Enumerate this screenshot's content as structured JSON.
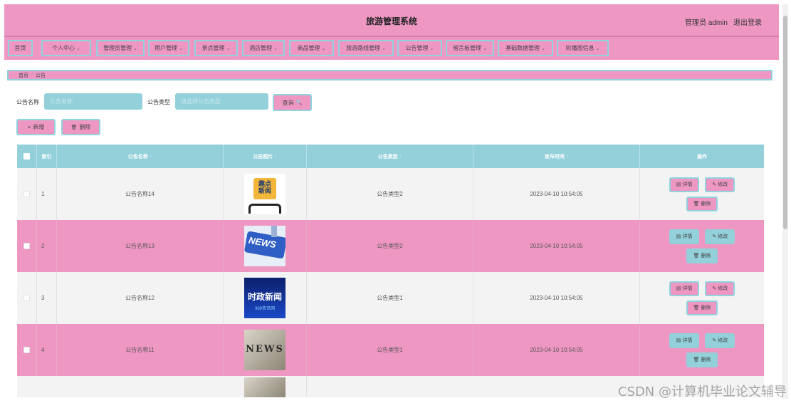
{
  "header": {
    "title": "旅游管理系统",
    "user": "管理员 admin",
    "logout": "退出登录"
  },
  "nav": [
    {
      "label": "首页",
      "chevron": ""
    },
    {
      "label": "个人中心",
      "chevron": "⌄"
    },
    {
      "label": "管理员管理",
      "chevron": "⌄"
    },
    {
      "label": "用户管理",
      "chevron": "⌄"
    },
    {
      "label": "景点管理",
      "chevron": "⌄"
    },
    {
      "label": "酒店管理",
      "chevron": "⌄"
    },
    {
      "label": "商品管理",
      "chevron": "⌄"
    },
    {
      "label": "旅游路线管理",
      "chevron": "⌄"
    },
    {
      "label": "公告管理",
      "chevron": "⌄"
    },
    {
      "label": "留言板管理",
      "chevron": "⌄"
    },
    {
      "label": "基础数据管理",
      "chevron": "⌄"
    },
    {
      "label": "轮播图信息",
      "chevron": "⌄"
    }
  ],
  "breadcrumb": {
    "home": "首页",
    "sep": "/",
    "current": "公告"
  },
  "search": {
    "name_label": "公告名称",
    "name_placeholder": "公告名称",
    "type_label": "公告类型",
    "type_placeholder": "请选择公告类型",
    "query_label": "查询",
    "query_icon": "🔍"
  },
  "actions": {
    "add_icon": "+",
    "add_label": "新增",
    "delete_icon": "🗑",
    "delete_label": "删除"
  },
  "table": {
    "columns": [
      "索引",
      "公告名称",
      "公告图片",
      "公告类型",
      "发布时间",
      "操作"
    ],
    "sort_icon": "↕",
    "rows": [
      {
        "index": "1",
        "name": "公告名称14",
        "image": "news-phone",
        "type": "公告类型2",
        "time": "2023-04-10 10:54:05"
      },
      {
        "index": "2",
        "name": "公告名称13",
        "image": "news-key",
        "type": "公告类型2",
        "time": "2023-04-10 10:54:05"
      },
      {
        "index": "3",
        "name": "公告名称12",
        "image": "news-politics",
        "type": "公告类型1",
        "time": "2023-04-10 10:54:05"
      },
      {
        "index": "4",
        "name": "公告名称11",
        "image": "news-paper",
        "type": "公告类型1",
        "time": "2023-04-10 10:54:05"
      }
    ],
    "ops": {
      "detail_icon": "▤",
      "detail": "详情",
      "edit_icon": "✎",
      "edit": "修改",
      "delete_icon": "🗑",
      "delete": "删除"
    }
  },
  "thumb_text": {
    "phone_line1": "趣点",
    "phone_line2": "新闻",
    "key": "NEWS",
    "politics_line1": "时政新闻",
    "politics_line2": "369资讯网",
    "paper": "NEWS"
  },
  "watermark": "CSDN @计算机毕业论文辅导",
  "colors": {
    "pink": "#ef97c3",
    "teal": "#93d0da",
    "teal_border": "#8fd3dd"
  }
}
